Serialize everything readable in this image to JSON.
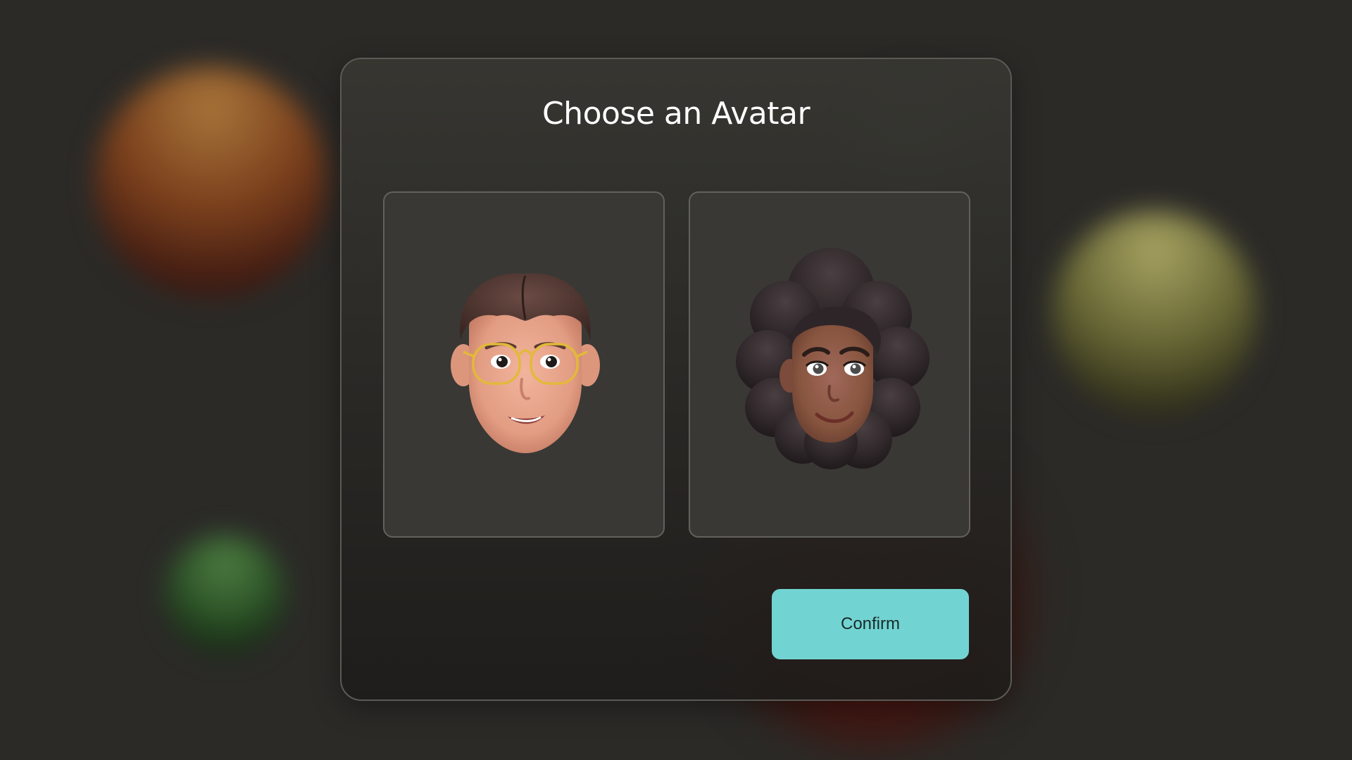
{
  "dialog": {
    "title": "Choose an Avatar",
    "confirm_label": "Confirm"
  },
  "avatars": [
    {
      "icon": "male-avatar-with-glasses-icon"
    },
    {
      "icon": "female-avatar-curly-hair-icon"
    }
  ],
  "colors": {
    "background": "#2b2a27",
    "dialog_border": "#5b5a55",
    "card_background": "#393835",
    "confirm_button": "#72d4d2"
  }
}
